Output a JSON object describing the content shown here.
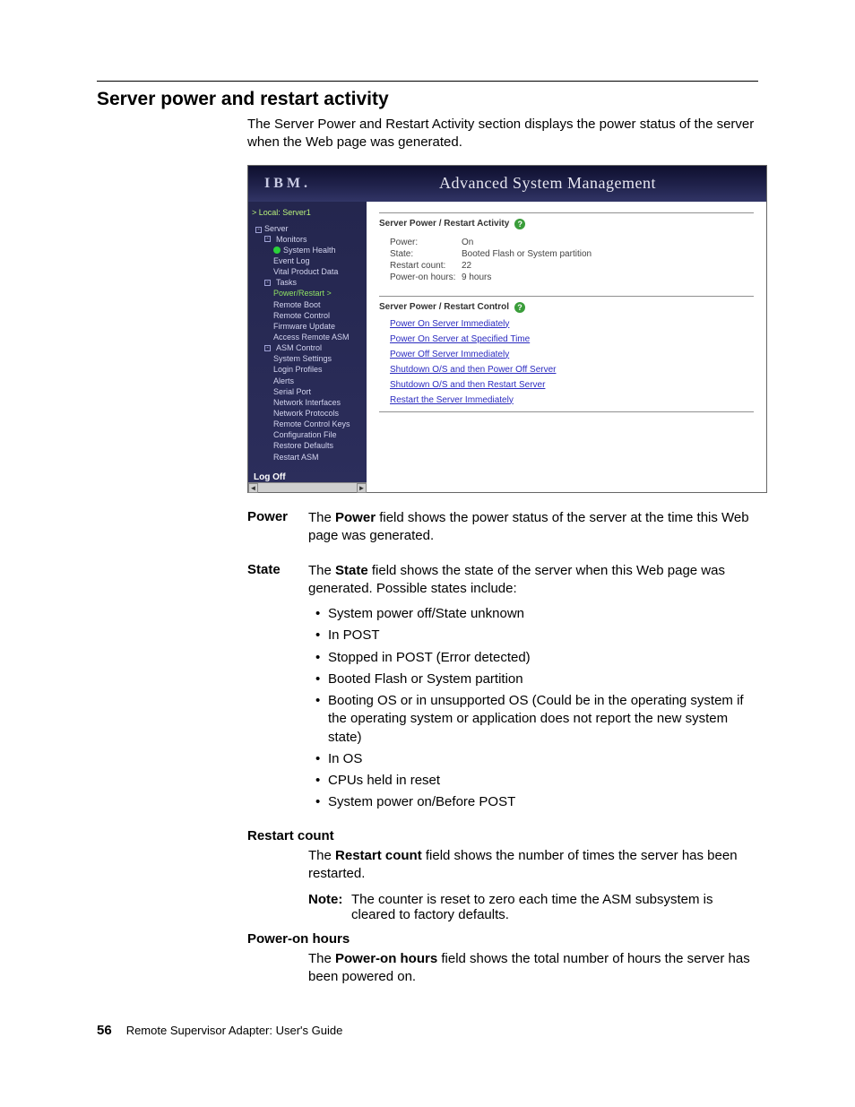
{
  "heading": "Server power and restart activity",
  "intro": "The Server Power and Restart Activity section displays the power status of the server when the Web page was generated.",
  "screenshot": {
    "logo": "IBM.",
    "title": "Advanced System Management",
    "breadcrumb": "> Local:  Server1",
    "nav": {
      "server": "Server",
      "monitors": "Monitors",
      "system_health": "System Health",
      "event_log": "Event Log",
      "vpd": "Vital Product Data",
      "tasks": "Tasks",
      "power_restart": "Power/Restart >",
      "remote_boot": "Remote Boot",
      "remote_control": "Remote Control",
      "firmware_update": "Firmware Update",
      "access_remote_asm": "Access Remote ASM",
      "asm_control": "ASM Control",
      "system_settings": "System Settings",
      "login_profiles": "Login Profiles",
      "alerts": "Alerts",
      "serial_port": "Serial Port",
      "network_interfaces": "Network Interfaces",
      "network_protocols": "Network Protocols",
      "remote_control_keys": "Remote Control Keys",
      "configuration_file": "Configuration File",
      "restore_defaults": "Restore Defaults",
      "restart_asm": "Restart ASM",
      "logoff": "Log Off"
    },
    "activity": {
      "title": "Server Power / Restart Activity",
      "power_k": "Power:",
      "power_v": "On",
      "state_k": "State:",
      "state_v": "Booted Flash or System partition",
      "restart_k": "Restart count:",
      "restart_v": "22",
      "poweron_k": "Power-on hours:",
      "poweron_v": "9 hours"
    },
    "control": {
      "title": "Server Power / Restart Control",
      "links": [
        "Power On Server Immediately",
        "Power On Server at Specified Time",
        "Power Off Server Immediately",
        "Shutdown O/S and then Power Off Server",
        "Shutdown O/S and then Restart Server",
        "Restart the Server Immediately"
      ]
    }
  },
  "defs": {
    "power": {
      "term": "Power",
      "text_a": "The ",
      "bold": "Power",
      "text_b": " field shows the power status of the server at the time this Web page was generated."
    },
    "state": {
      "term": "State",
      "text_a": "The ",
      "bold": "State",
      "text_b": " field shows the state of the server when this Web page was generated. Possible states include:",
      "bullets": [
        "System power off/State unknown",
        "In POST",
        "Stopped in POST (Error detected)",
        "Booted Flash or System partition",
        "Booting OS or in unsupported OS (Could be in the operating system if the operating system or application does not report the new system state)",
        "In OS",
        "CPUs held in reset",
        "System power on/Before POST"
      ]
    },
    "restart": {
      "term": "Restart count",
      "text_a": "The ",
      "bold": "Restart count",
      "text_b": " field shows the number of times the server has been restarted.",
      "note_k": "Note:",
      "note_v": "The counter is reset to zero each time the ASM subsystem is cleared to factory defaults."
    },
    "poweron": {
      "term": "Power-on hours",
      "text_a": "The ",
      "bold": "Power-on hours",
      "text_b": " field shows the total number of hours the server has been powered on."
    }
  },
  "footer": {
    "page": "56",
    "book": "Remote Supervisor Adapter:  User's Guide"
  }
}
